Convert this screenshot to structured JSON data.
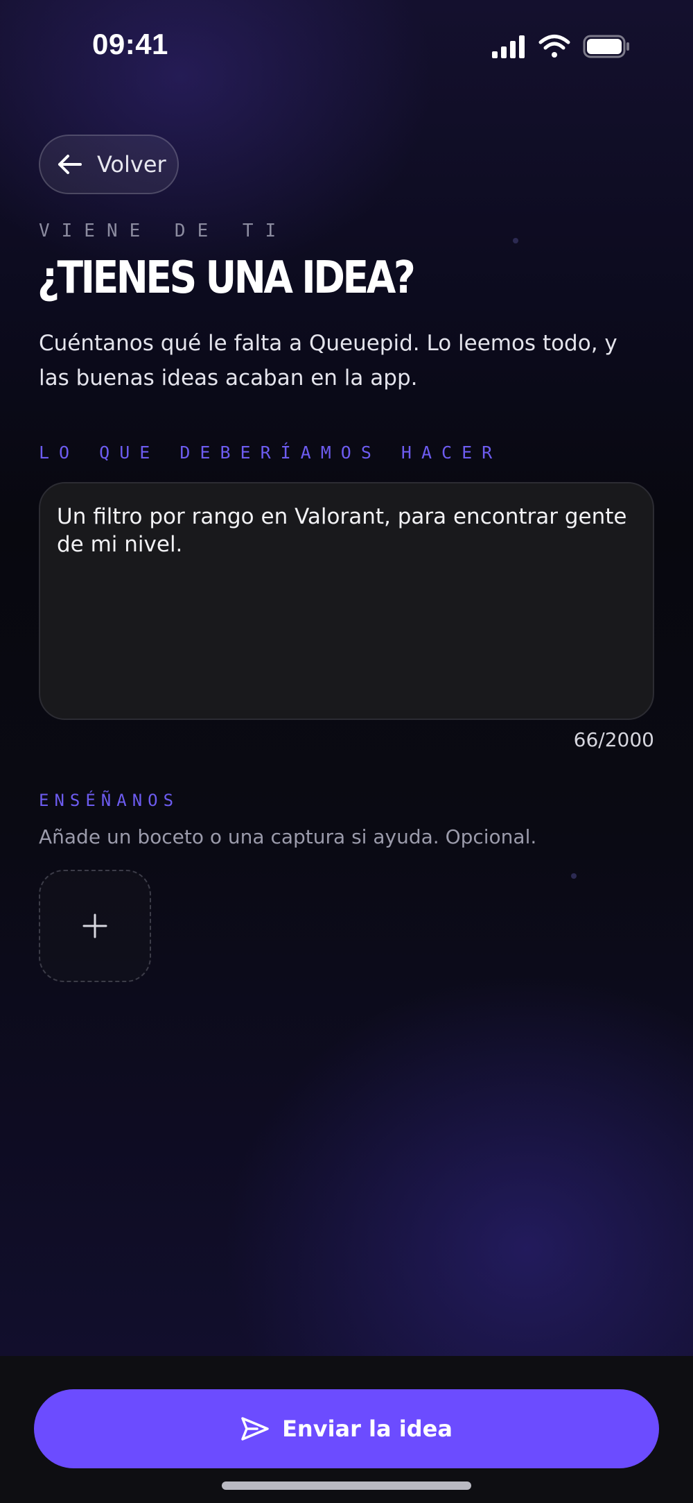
{
  "status_bar": {
    "time": "09:41"
  },
  "header": {
    "back_label": "Volver",
    "eyebrow": "VIENE DE TI",
    "title": "¿TIENES UNA IDEA?",
    "subtitle": "Cuéntanos qué le falta a Queuepid. Lo leemos todo, y las buenas ideas acaban en la app."
  },
  "idea_field": {
    "label": "LO QUE DEBERÍAMOS HACER",
    "value": "Un filtro por rango en Valorant, para encontrar gente de mi nivel.",
    "counter": "66/2000"
  },
  "attachment": {
    "label": "ENSÉÑANOS",
    "help": "Añade un boceto o una captura si ayuda. Opcional."
  },
  "submit": {
    "label": "Enviar la idea"
  },
  "colors": {
    "accent": "#6c4cff",
    "label_accent": "#6d5cf0",
    "field_background": "#19191c"
  },
  "icons": {
    "back": "arrow-left-icon",
    "add": "plus-icon",
    "send": "send-icon",
    "signal": "cellular-signal-icon",
    "wifi": "wifi-icon",
    "battery": "battery-icon"
  }
}
